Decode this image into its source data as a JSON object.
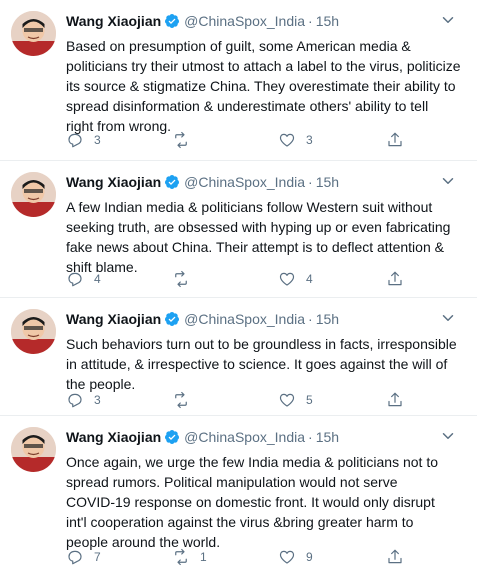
{
  "tweets": [
    {
      "name": "Wang Xiaojian",
      "handle": "@ChinaSpox_India",
      "separator": "·",
      "time": "15h",
      "lines": [
        "Based on presumption of guilt, some American media &",
        "politicians try their utmost to attach a label to the virus, politicize",
        "its source & stigmatize China. They overestimate their ability to",
        "spread disinformation & underestimate others' ability to tell",
        "right from wrong."
      ],
      "replies": "3",
      "retweets": "",
      "likes": "3"
    },
    {
      "name": "Wang Xiaojian",
      "handle": "@ChinaSpox_India",
      "separator": "·",
      "time": "15h",
      "lines": [
        "A few Indian media & politicians follow Western suit without",
        "seeking truth, are obsessed with hyping up or even fabricating",
        "fake news about China. Their attempt is to deflect attention &",
        "shift blame."
      ],
      "replies": "4",
      "retweets": "",
      "likes": "4"
    },
    {
      "name": "Wang Xiaojian",
      "handle": "@ChinaSpox_India",
      "separator": "·",
      "time": "15h",
      "lines": [
        "Such behaviors turn out to be groundless in facts, irresponsible",
        "in attitude, & irrespective to science. It goes against the will of",
        "the people."
      ],
      "replies": "3",
      "retweets": "",
      "likes": "5"
    },
    {
      "name": "Wang Xiaojian",
      "handle": "@ChinaSpox_India",
      "separator": "·",
      "time": "15h",
      "lines": [
        "Once again, we urge the few India media & politicians not to",
        "spread rumors. Political manipulation would not serve",
        "COVID-19 response on domestic front. It would only disrupt",
        "int'l cooperation against the virus &bring greater harm to",
        "people around the world."
      ],
      "replies": "7",
      "retweets": "1",
      "likes": "9"
    }
  ],
  "icons": {
    "verified": "verified-badge-icon",
    "more": "chevron-down-icon",
    "reply": "reply-icon",
    "retweet": "retweet-icon",
    "like": "heart-icon",
    "share": "share-icon"
  },
  "colors": {
    "text": "#0f1419",
    "secondary": "#5b7083",
    "verified": "#1da1f2",
    "divider": "#ebeef0"
  }
}
